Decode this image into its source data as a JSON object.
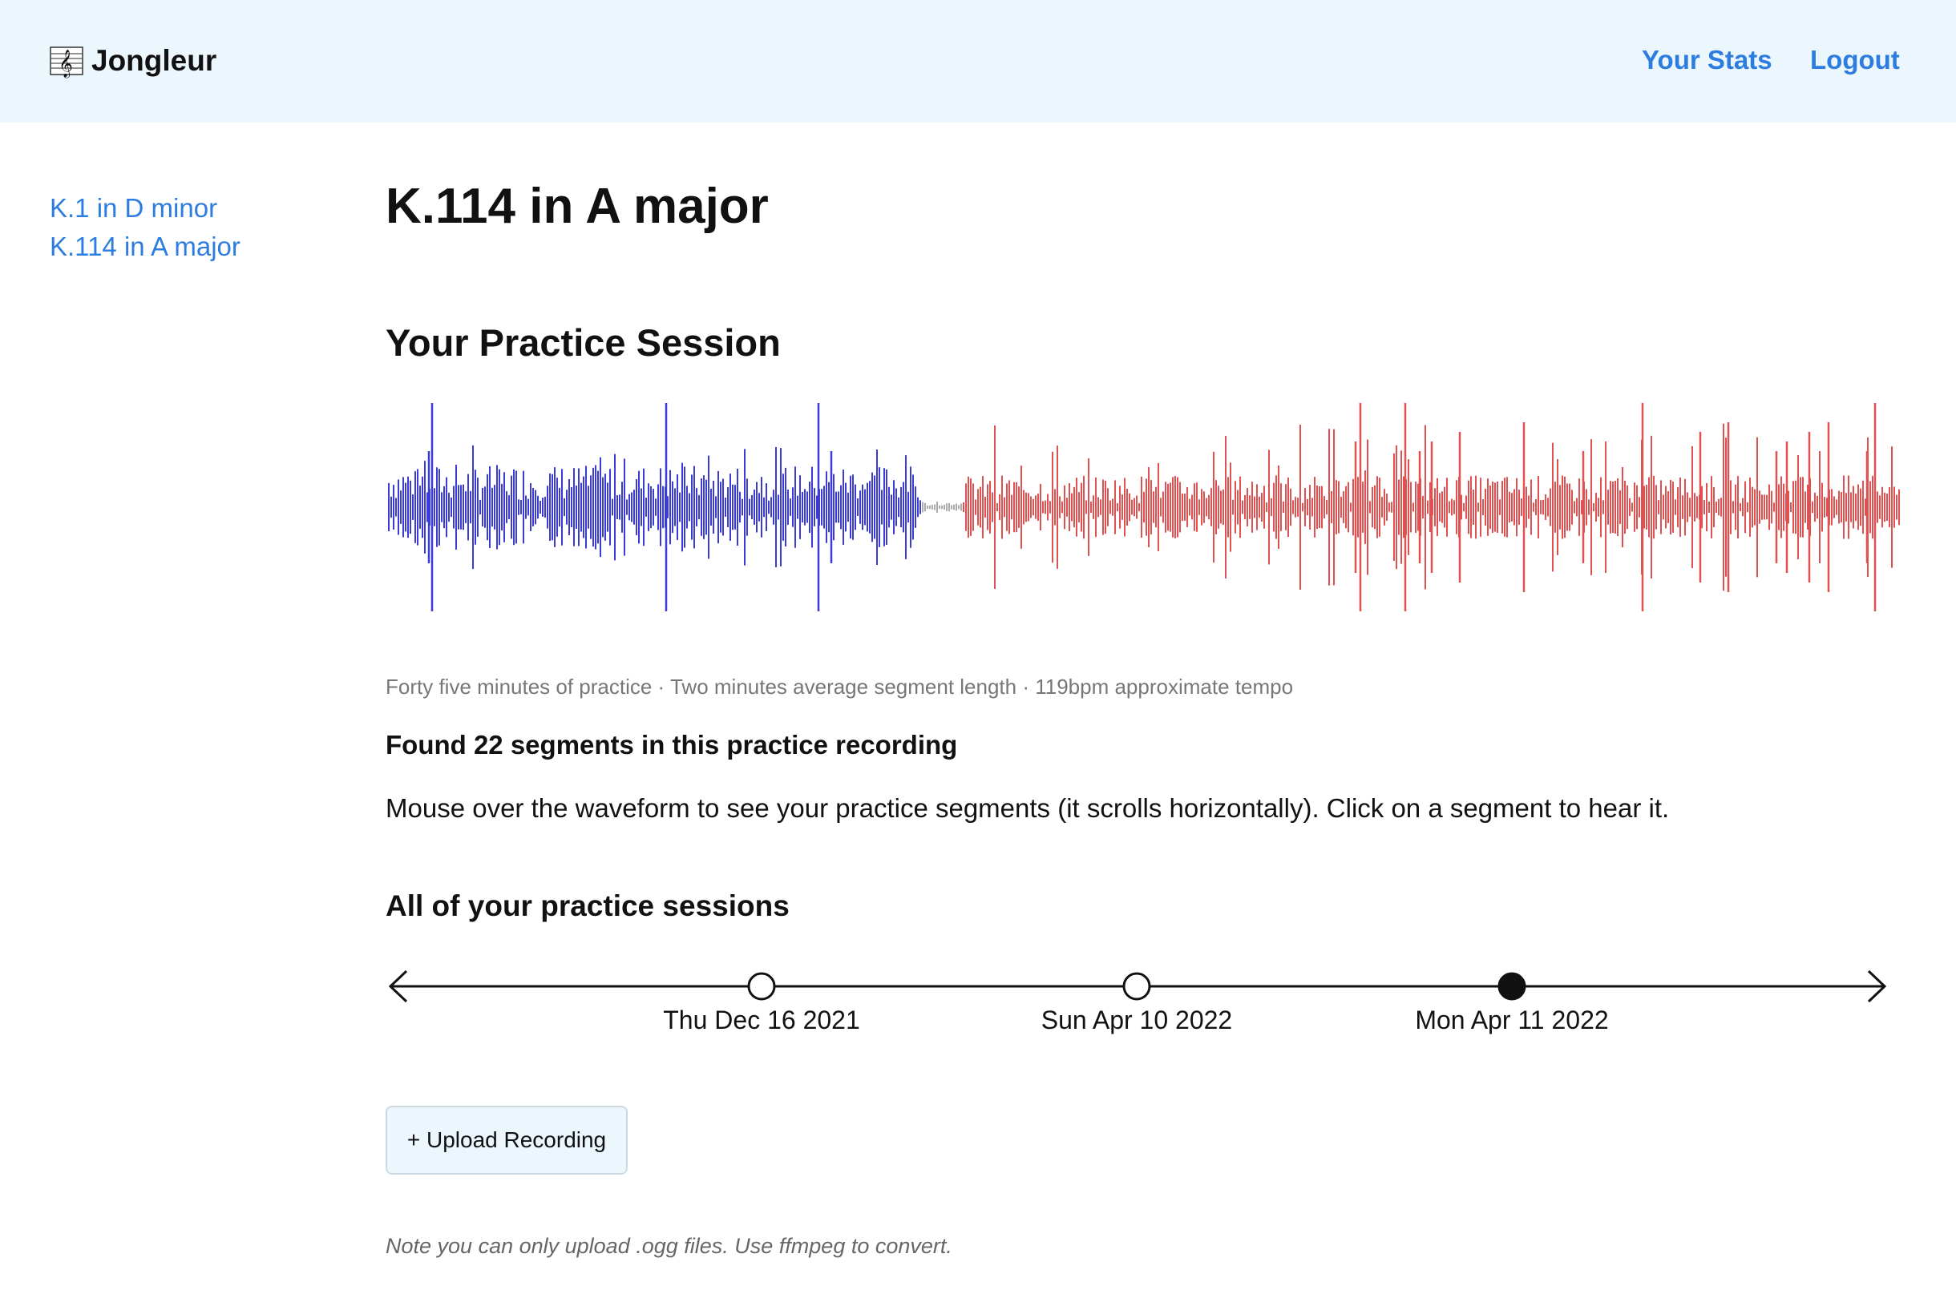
{
  "header": {
    "brand": "Jongleur",
    "brand_icon": "music-score-icon",
    "nav": {
      "stats": "Your Stats",
      "logout": "Logout"
    }
  },
  "sidebar": {
    "items": [
      {
        "label": "K.1 in D minor"
      },
      {
        "label": "K.114 in A major"
      }
    ]
  },
  "main": {
    "title": "K.114 in A major",
    "session_heading": "Your Practice Session",
    "meta": "Forty five minutes of practice · Two minutes average segment length · 119bpm approximate tempo",
    "found": "Found 22 segments in this practice recording",
    "instructions": "Mouse over the waveform to see your practice segments (it scrolls horizontally). Click on a segment to hear it.",
    "sessions_heading": "All of your practice sessions",
    "sessions": [
      {
        "label": "Thu Dec 16 2021",
        "selected": false
      },
      {
        "label": "Sun Apr 10 2022",
        "selected": false
      },
      {
        "label": "Mon Apr 11 2022",
        "selected": true
      }
    ],
    "upload_label": "+ Upload Recording",
    "note": "Note you can only upload .ogg files. Use ffmpeg to convert."
  },
  "colors": {
    "accent": "#2d7de0",
    "header_bg": "#ebf6fd",
    "wave_played": "#3b3bd6",
    "wave_gap": "#aaaaaa",
    "wave_unplayed": "#e05252"
  }
}
